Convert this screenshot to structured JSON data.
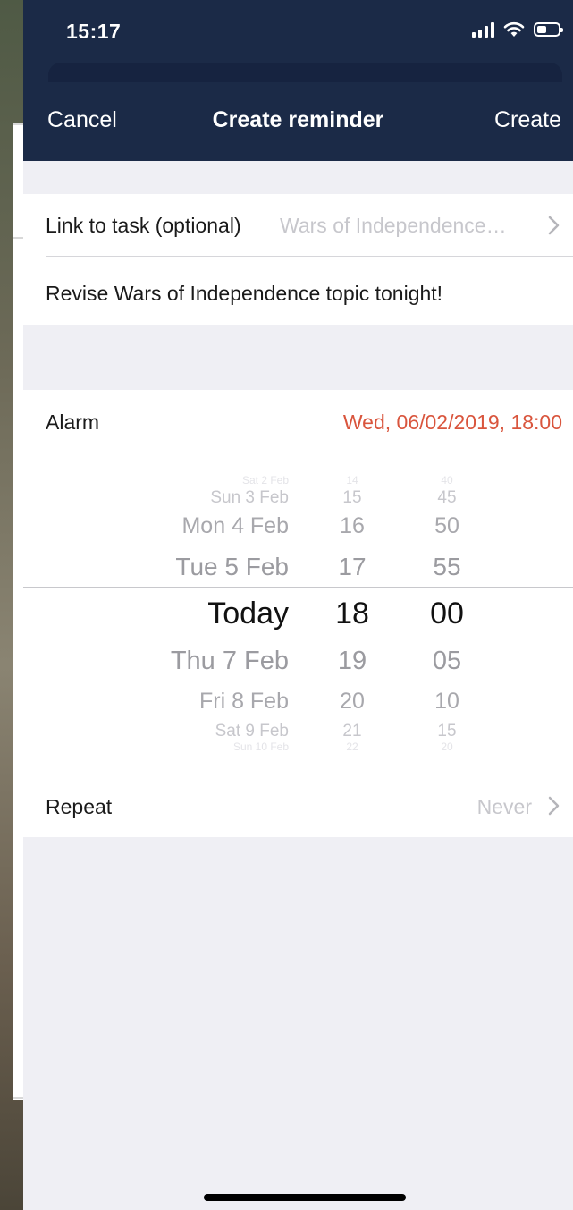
{
  "status_bar": {
    "time": "15:17"
  },
  "nav": {
    "cancel": "Cancel",
    "title": "Create reminder",
    "create": "Create"
  },
  "link_row": {
    "label": "Link to task (optional)",
    "value": "Wars of Independence…",
    "chevron": "chevron-right-icon"
  },
  "note": {
    "text": "Revise Wars of Independence topic tonight!"
  },
  "alarm": {
    "label": "Alarm",
    "value": "Wed, 06/02/2019, 18:00",
    "value_color": "#d9553d"
  },
  "picker": {
    "dates": [
      "Sat 2 Feb",
      "Sun 3 Feb",
      "Mon 4 Feb",
      "Tue 5 Feb",
      "Today",
      "Thu 7 Feb",
      "Fri 8 Feb",
      "Sat 9 Feb",
      "Sun 10 Feb"
    ],
    "hours": [
      "14",
      "15",
      "16",
      "17",
      "18",
      "19",
      "20",
      "21",
      "22"
    ],
    "minutes": [
      "40",
      "45",
      "50",
      "55",
      "00",
      "05",
      "10",
      "15",
      "20"
    ],
    "selected_index": 4
  },
  "repeat": {
    "label": "Repeat",
    "value": "Never",
    "chevron": "chevron-right-icon"
  },
  "colors": {
    "nav_bg": "#1b2a47",
    "accent": "#d9553d",
    "grouped_bg": "#efeff4"
  }
}
